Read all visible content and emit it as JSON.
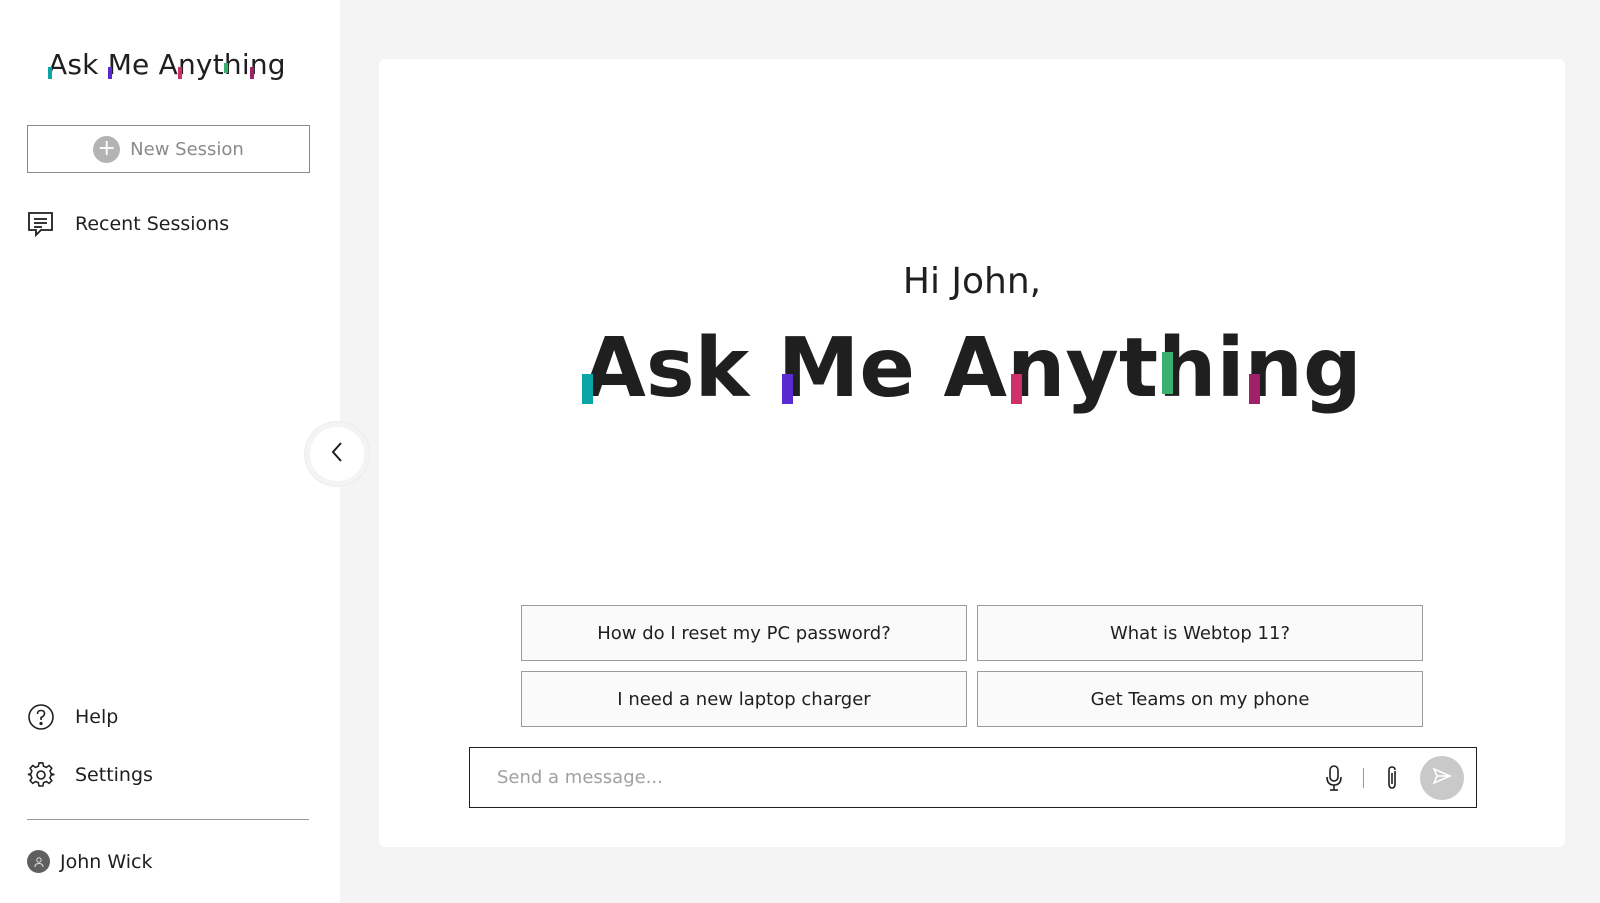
{
  "app": {
    "brand_letters": [
      {
        "ch": "A",
        "mark": "#0aa6a6"
      },
      {
        "ch": "s"
      },
      {
        "ch": "k"
      },
      {
        "ch": " "
      },
      {
        "ch": "M",
        "mark": "#5a2bd0"
      },
      {
        "ch": "e"
      },
      {
        "ch": " "
      },
      {
        "ch": "A"
      },
      {
        "ch": "n",
        "mark": "#d0306a"
      },
      {
        "ch": "y"
      },
      {
        "ch": "t"
      },
      {
        "ch": "h",
        "mark": "#3ab06e"
      },
      {
        "ch": "i"
      },
      {
        "ch": "n",
        "mark": "#a0206a"
      },
      {
        "ch": "g"
      }
    ]
  },
  "sidebar": {
    "new_session_label": "New Session",
    "recent_sessions_label": "Recent Sessions",
    "help_label": "Help",
    "settings_label": "Settings",
    "user_name": "John Wick"
  },
  "main": {
    "greeting": "Hi John,",
    "suggestions": [
      "How do I reset my PC password?",
      "What is Webtop 11?",
      "I need a new laptop charger",
      "Get Teams on my phone"
    ],
    "composer": {
      "placeholder": "Send a message..."
    }
  },
  "icons": {
    "new_session": "plus-circle-icon",
    "recent": "chat-lines-icon",
    "help": "question-circle-icon",
    "settings": "gear-icon",
    "user": "user-avatar-icon",
    "collapse": "chevron-left-icon",
    "mic": "microphone-icon",
    "attach": "paperclip-icon",
    "send": "send-icon"
  },
  "colors": {
    "accent_teal": "#0aa6a6",
    "accent_purple": "#5a2bd0",
    "accent_pink": "#d0306a",
    "accent_green": "#3ab06e",
    "accent_magenta": "#a0206a"
  }
}
